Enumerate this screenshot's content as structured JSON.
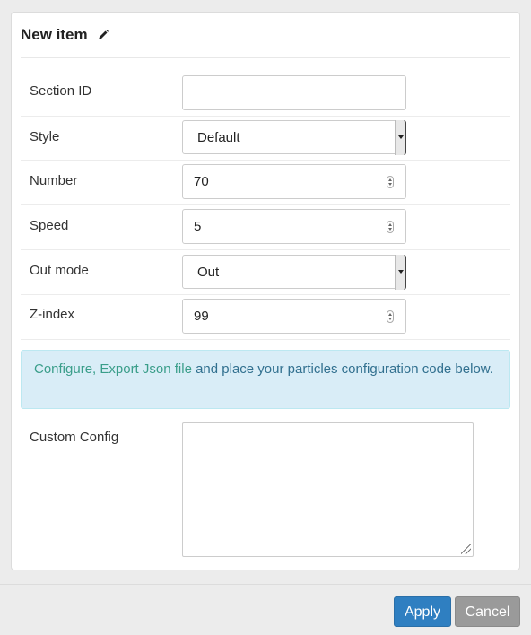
{
  "header": {
    "title": "New item",
    "edit_icon": "pencil-icon"
  },
  "form": {
    "section_id": {
      "label": "Section ID",
      "value": ""
    },
    "style": {
      "label": "Style",
      "value": "Default"
    },
    "number": {
      "label": "Number",
      "value": "70"
    },
    "speed": {
      "label": "Speed",
      "value": "5"
    },
    "out_mode": {
      "label": "Out mode",
      "value": "Out"
    },
    "z_index": {
      "label": "Z-index",
      "value": "99"
    },
    "custom_config": {
      "label": "Custom Config",
      "value": ""
    }
  },
  "info": {
    "link_text": "Configure, Export Json file",
    "text": " and place your particles configuration code below."
  },
  "footer": {
    "apply_label": "Apply",
    "cancel_label": "Cancel"
  },
  "colors": {
    "primary": "#2f7fc1",
    "info_bg": "#d9edf7",
    "info_text": "#31708f",
    "link": "#3a9e8a",
    "cancel": "#9a9a9a"
  }
}
